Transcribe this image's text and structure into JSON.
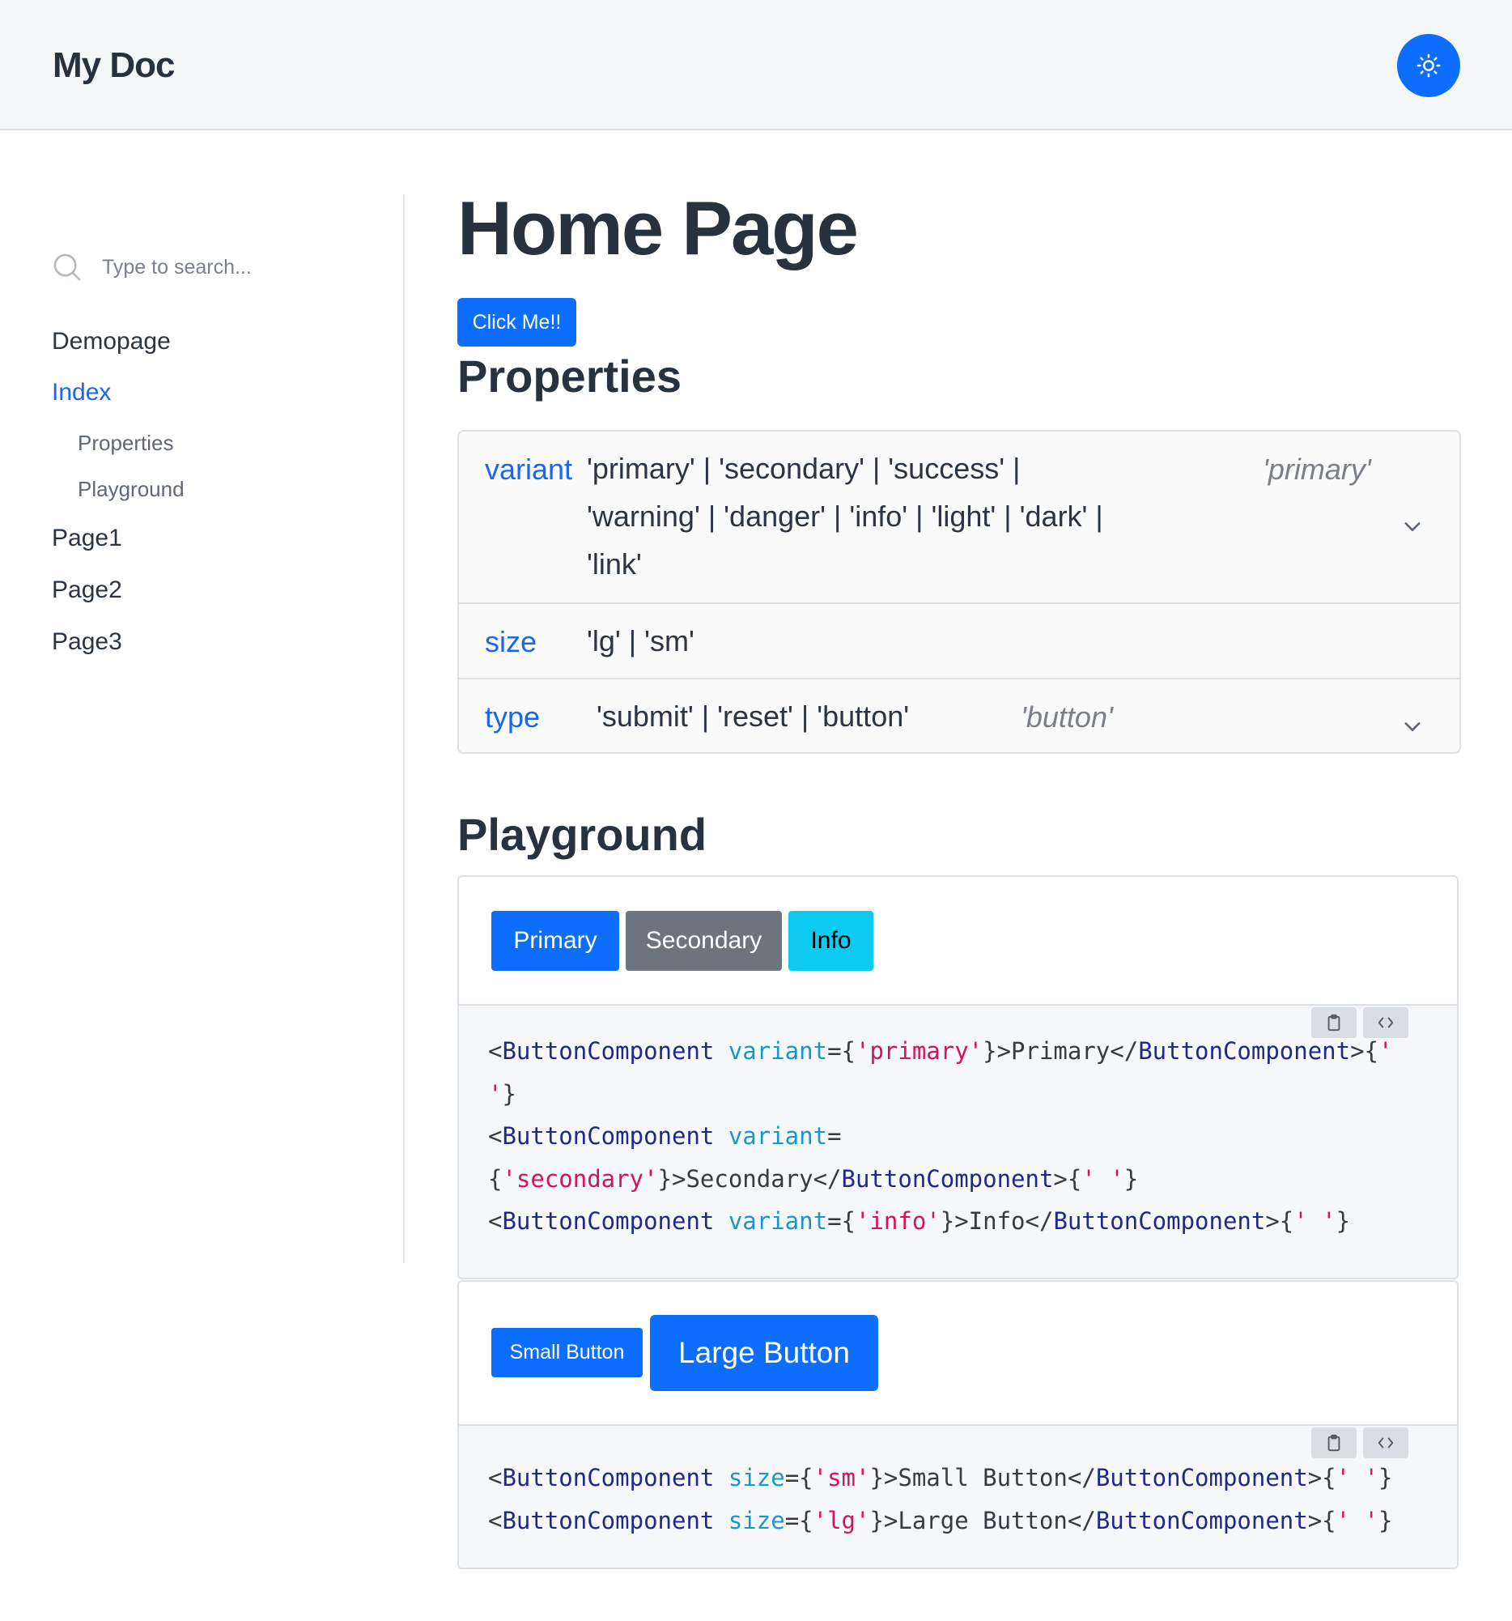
{
  "header": {
    "brand": "My Doc",
    "theme_icon": "sun-icon"
  },
  "sidebar": {
    "search_placeholder": "Type to search...",
    "items": [
      {
        "label": "Demopage",
        "active": false
      },
      {
        "label": "Index",
        "active": true
      },
      {
        "label": "Properties",
        "sub": true
      },
      {
        "label": "Playground",
        "sub": true
      },
      {
        "label": "Page1",
        "active": false
      },
      {
        "label": "Page2",
        "active": false
      },
      {
        "label": "Page3",
        "active": false
      }
    ]
  },
  "main": {
    "title": "Home Page",
    "click_button": "Click Me!!",
    "properties_title": "Properties",
    "properties": [
      {
        "name": "variant",
        "type_lines": [
          "'primary' | 'secondary' | 'success' |",
          "'warning' | 'danger' | 'info' | 'light' | 'dark' |",
          "'link'"
        ],
        "default": "'primary'"
      },
      {
        "name": "size",
        "type_lines": [
          "'lg' | 'sm'"
        ],
        "default": ""
      },
      {
        "name": "type",
        "type_lines": [
          "'submit' | 'reset' | 'button'"
        ],
        "default": "'button'"
      }
    ],
    "playground_title": "Playground",
    "playground1": {
      "buttons": [
        "Primary",
        "Secondary",
        "Info"
      ]
    },
    "playground2": {
      "buttons": [
        "Small Button",
        "Large Button"
      ]
    }
  },
  "colors": {
    "accent": "#0d6efd",
    "secondary": "#6c757d",
    "info": "#0dcaf0"
  }
}
